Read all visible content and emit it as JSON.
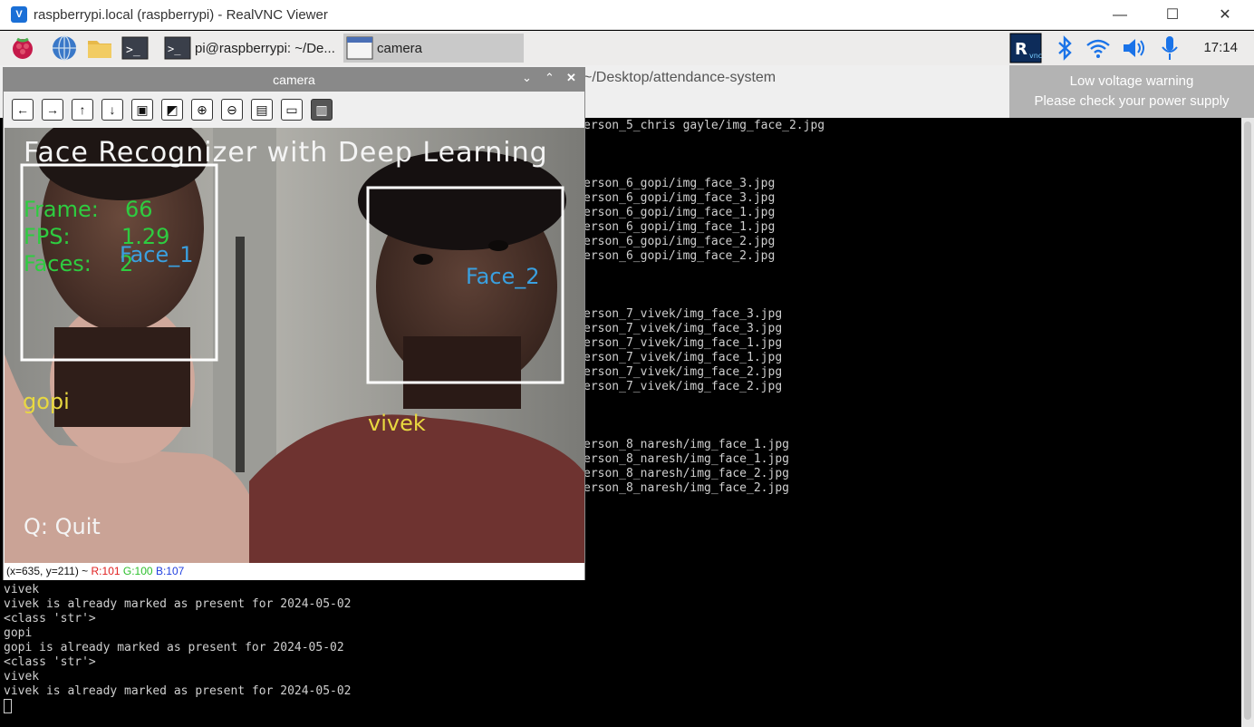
{
  "vnc": {
    "title": "raspberrypi.local (raspberrypi) - RealVNC Viewer",
    "minimize": "—",
    "maximize": "☐",
    "close": "✕"
  },
  "taskbar": {
    "tasks": [
      {
        "label": "pi@raspberrypi: ~/De..."
      },
      {
        "label": "camera"
      }
    ],
    "clock": "17:14"
  },
  "warning": {
    "line1": "Low voltage warning",
    "line2": "Please check your power supply"
  },
  "terminal": {
    "path": "~/Desktop/attendance-system",
    "upper_lines": [
      "erson_5_chris gayle/img_face_2.jpg",
      "erson_6_gopi/img_face_3.jpg",
      "erson_6_gopi/img_face_3.jpg",
      "erson_6_gopi/img_face_1.jpg",
      "erson_6_gopi/img_face_1.jpg",
      "erson_6_gopi/img_face_2.jpg",
      "erson_6_gopi/img_face_2.jpg",
      "erson_7_vivek/img_face_3.jpg",
      "erson_7_vivek/img_face_3.jpg",
      "erson_7_vivek/img_face_1.jpg",
      "erson_7_vivek/img_face_1.jpg",
      "erson_7_vivek/img_face_2.jpg",
      "erson_7_vivek/img_face_2.jpg",
      "erson_8_naresh/img_face_1.jpg",
      "erson_8_naresh/img_face_1.jpg",
      "erson_8_naresh/img_face_2.jpg",
      "erson_8_naresh/img_face_2.jpg"
    ],
    "lower_lines": [
      "vivek",
      "vivek is already marked as present for 2024-05-02",
      "<class 'str'>",
      "gopi",
      "gopi is already marked as present for 2024-05-02",
      "<class 'str'>",
      "vivek",
      "vivek is already marked as present for 2024-05-02"
    ]
  },
  "camera": {
    "title": "camera",
    "heading": "Face Recognizer with Deep Learning",
    "frame_label": "Frame:",
    "frame_value": "66",
    "fps_label": "FPS:",
    "fps_value": "1.29",
    "faces_label": "Faces:",
    "faces_value": "2",
    "face1_label": "Face_1",
    "face2_label": "Face_2",
    "name1": "gopi",
    "name2": "vivek",
    "quit_text": "Q: Quit",
    "status_coords": "(x=635, y=211) ~",
    "status_r": "R:101",
    "status_g": "G:100",
    "status_b": "B:107",
    "colors": {
      "green": "#2ecc40",
      "blue": "#3aa0e0",
      "yellow": "#e8d840"
    }
  },
  "icons": {
    "toolbar": [
      "arrow-left-icon",
      "arrow-right-icon",
      "arrow-up-icon",
      "arrow-down-icon",
      "image-icon",
      "image-settings-icon",
      "zoom-in-icon",
      "zoom-out-icon",
      "save-icon",
      "clipboard-icon",
      "properties-icon"
    ]
  }
}
